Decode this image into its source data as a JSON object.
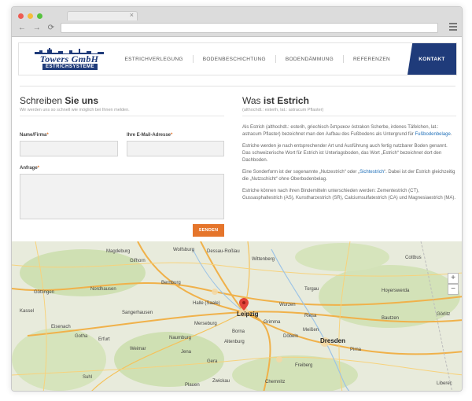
{
  "browser": {
    "dot_colors": [
      "#ee5b52",
      "#f5bc3b",
      "#56c23f"
    ],
    "tab_close": "×",
    "nav": {
      "back": "←",
      "forward": "→",
      "reload": "⟳"
    }
  },
  "site": {
    "logo_name": "Towers GmbH",
    "logo_sub": "ESTRICHSYSTEME",
    "nav_items": [
      "ESTRICHVERLEGUNG",
      "BODENBESCHICHTUNG",
      "BODENDÄMMUNG",
      "REFERENZEN"
    ],
    "nav_cta": "KONTAKT"
  },
  "contact": {
    "title_light": "Schreiben ",
    "title_bold": "Sie uns",
    "subtitle": "Wir werden uns so schnell wie möglich bei Ihnen melden.",
    "field_name": "Name/Firma",
    "field_email": "Ihre E-Mail-Adresse",
    "field_message": "Anfrage",
    "required_mark": "*",
    "submit": "SENDEN"
  },
  "info": {
    "title_light": "Was ",
    "title_bold": "ist Estrich",
    "subtitle": "(althochdt.: esterih, lat.: astracum Pflaster)",
    "p1_a": "Als Estrich (althochdt.: esterih, griechisch ὄστρακον óstrakon Scherbe, irdenes Täfelchen, lat.: astracum Pflaster) bezeichnet man den Aufbau des Fußbodens als Untergrund für ",
    "p1_link": "Fußbodenbelage",
    "p1_b": ".",
    "p2": "Estriche werden je nach entsprechender Art und Ausführung auch fertig nutzbarer Boden genannt. Das schweizerische Wort für Estrich ist Unterlagsboden, das Wort „Estrich“ bezeichnet dort den Dachboden.",
    "p3_a": "Eine Sonderform ist der sogenannte „Nutzestrich“ oder „",
    "p3_link": "Sichtestrich",
    "p3_b": "“. Dabei ist der Estrich gleichzeitig die „Nutzschicht“ ohne Oberbodenbelag.",
    "p4": "Estriche können nach ihren Bindemitteln unterschieden werden: Zementestrich (CT), Gussasphaltestrich (AS), Kunstharzestrich (SR), Calciumsulfatestrich (CA) und Magnesiaestrich (MA)."
  },
  "map": {
    "zoom_in": "+",
    "zoom_out": "−",
    "labels": [
      {
        "t": "Wolfsburg",
        "big": false
      },
      {
        "t": "Gifhorn",
        "big": false
      },
      {
        "t": "Göttingen",
        "big": false
      },
      {
        "t": "Kassel",
        "big": false
      },
      {
        "t": "Halle (Saale)",
        "big": false
      },
      {
        "t": "Leipzig",
        "big": true
      },
      {
        "t": "Dessau-Roßlau",
        "big": false
      },
      {
        "t": "Wittenberg",
        "big": false
      },
      {
        "t": "Merseburg",
        "big": false
      },
      {
        "t": "Naumburg",
        "big": false
      },
      {
        "t": "Weimar",
        "big": false
      },
      {
        "t": "Erfurt",
        "big": false
      },
      {
        "t": "Jena",
        "big": false
      },
      {
        "t": "Gera",
        "big": false
      },
      {
        "t": "Zwickau",
        "big": false
      },
      {
        "t": "Chemnitz",
        "big": false
      },
      {
        "t": "Dresden",
        "big": true
      },
      {
        "t": "Meißen",
        "big": false
      },
      {
        "t": "Riesa",
        "big": false
      },
      {
        "t": "Wurzen",
        "big": false
      },
      {
        "t": "Torgau",
        "big": false
      },
      {
        "t": "Bautzen",
        "big": false
      },
      {
        "t": "Görlitz",
        "big": false
      },
      {
        "t": "Liberec",
        "big": false
      },
      {
        "t": "Eisenach",
        "big": false
      },
      {
        "t": "Gotha",
        "big": false
      },
      {
        "t": "Nordhausen",
        "big": false
      },
      {
        "t": "Sangerhausen",
        "big": false
      },
      {
        "t": "Bernburg",
        "big": false
      },
      {
        "t": "Magdeburg",
        "big": false
      },
      {
        "t": "Cottbus",
        "big": false
      },
      {
        "t": "Hoyerswerda",
        "big": false
      },
      {
        "t": "Pirna",
        "big": false
      },
      {
        "t": "Freiberg",
        "big": false
      },
      {
        "t": "Plauen",
        "big": false
      },
      {
        "t": "Suhl",
        "big": false
      },
      {
        "t": "Altenburg",
        "big": false
      },
      {
        "t": "Borna",
        "big": false
      },
      {
        "t": "Grimma",
        "big": false
      },
      {
        "t": "Döbeln",
        "big": false
      }
    ]
  }
}
